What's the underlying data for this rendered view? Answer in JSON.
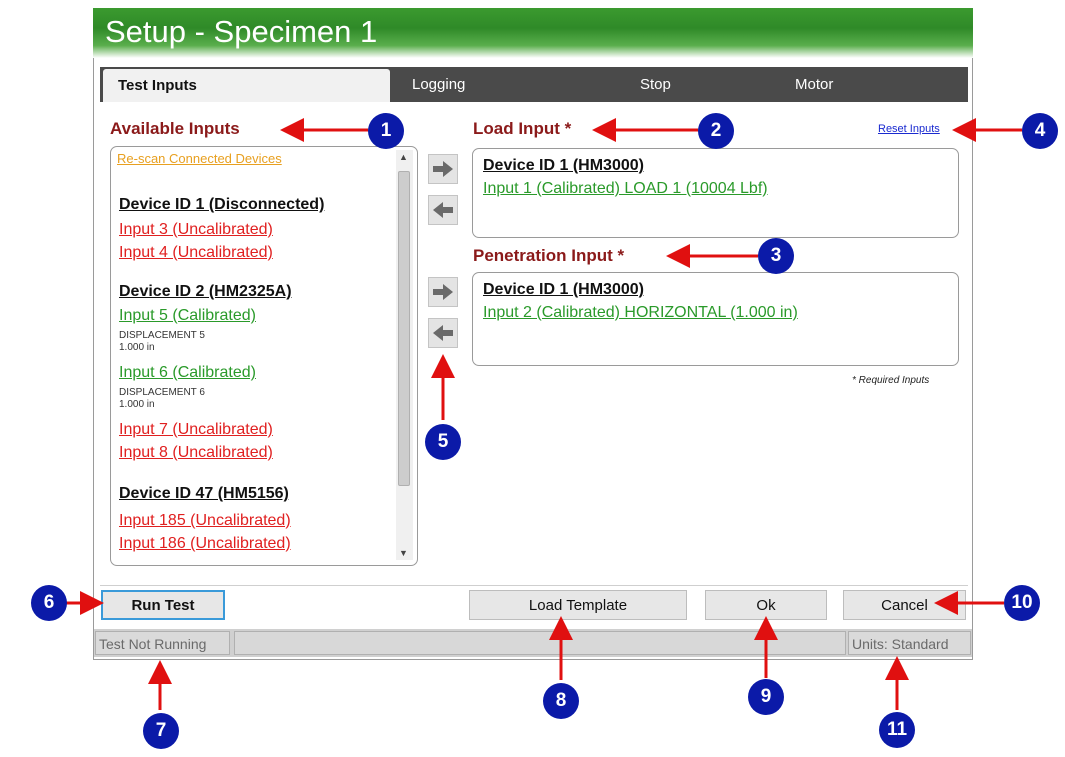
{
  "window": {
    "title": "Setup - Specimen 1"
  },
  "tabs": [
    "Test Inputs",
    "Logging",
    "Stop",
    "Motor"
  ],
  "available": {
    "heading": "Available Inputs",
    "rescan": "Re-scan Connected Devices",
    "devices": [
      {
        "name": "Device ID 1 (Disconnected)",
        "inputs": [
          "Input 3 (Uncalibrated)",
          "Input 4 (Uncalibrated)"
        ]
      },
      {
        "name": "Device ID 2 (HM2325A)",
        "input5": "Input 5 (Calibrated)",
        "input5_sub": "DISPLACEMENT 5",
        "input5_cap": "1.000 in",
        "input6": "Input 6 (Calibrated)",
        "input6_sub": "DISPLACEMENT 6",
        "input6_cap": "1.000 in",
        "inputs": [
          "Input 7 (Uncalibrated)",
          "Input 8 (Uncalibrated)"
        ]
      },
      {
        "name": "Device ID 47 (HM5156)",
        "inputs": [
          "Input 185 (Uncalibrated)",
          "Input 186 (Uncalibrated)"
        ]
      }
    ]
  },
  "load": {
    "heading": "Load Input *",
    "device": "Device ID 1 (HM3000)",
    "input": "Input 1 (Calibrated) LOAD 1 (10004 Lbf)"
  },
  "penetration": {
    "heading": "Penetration Input *",
    "device": "Device ID 1 (HM3000)",
    "input": "Input 2 (Calibrated) HORIZONTAL (1.000 in)"
  },
  "reset_label": "Reset Inputs",
  "required_note": "* Required Inputs",
  "buttons": {
    "run": "Run Test",
    "template": "Load Template",
    "ok": "Ok",
    "cancel": "Cancel"
  },
  "status": {
    "left": "Test Not Running",
    "units": "Units: Standard"
  },
  "callouts": [
    "1",
    "2",
    "3",
    "4",
    "5",
    "6",
    "7",
    "8",
    "9",
    "10",
    "11"
  ],
  "colors": {
    "title_green": "#3b9a2f",
    "heading_red": "#8b1a1a",
    "uncal_red": "#e02020",
    "cal_green": "#2a9a2a",
    "callout_blue": "#0b1aa8",
    "arrow_red": "#e01010"
  },
  "icons": [
    "arrow-right-icon",
    "arrow-left-icon",
    "scroll-up-icon",
    "scroll-down-icon"
  ]
}
